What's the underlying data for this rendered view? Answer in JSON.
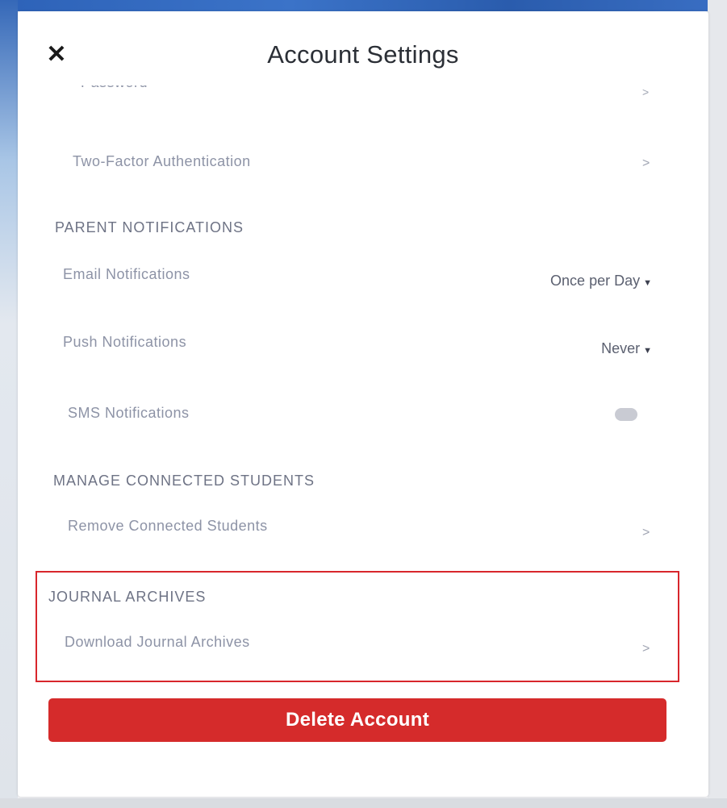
{
  "modal": {
    "title": "Account Settings"
  },
  "security": {
    "password_label": "Password",
    "two_factor_label": "Two-Factor Authentication"
  },
  "parent_notifications": {
    "header": "PARENT NOTIFICATIONS",
    "items": [
      {
        "label": "Email Notifications",
        "value": "Once per Day"
      },
      {
        "label": "Push Notifications",
        "value": "Never"
      },
      {
        "label": "SMS Notifications",
        "toggle_on": false
      }
    ]
  },
  "manage_students": {
    "header": "MANAGE CONNECTED STUDENTS",
    "remove_label": "Remove Connected Students"
  },
  "journal_archives": {
    "header": "JOURNAL ARCHIVES",
    "download_label": "Download Journal Archives"
  },
  "actions": {
    "delete_label": "Delete Account"
  },
  "colors": {
    "delete_button": "#d52b2b",
    "highlight_border": "#d8262c"
  },
  "icons": {
    "close": "close-icon",
    "chevron": "chevron-right-icon",
    "caret": "caret-down-icon"
  }
}
